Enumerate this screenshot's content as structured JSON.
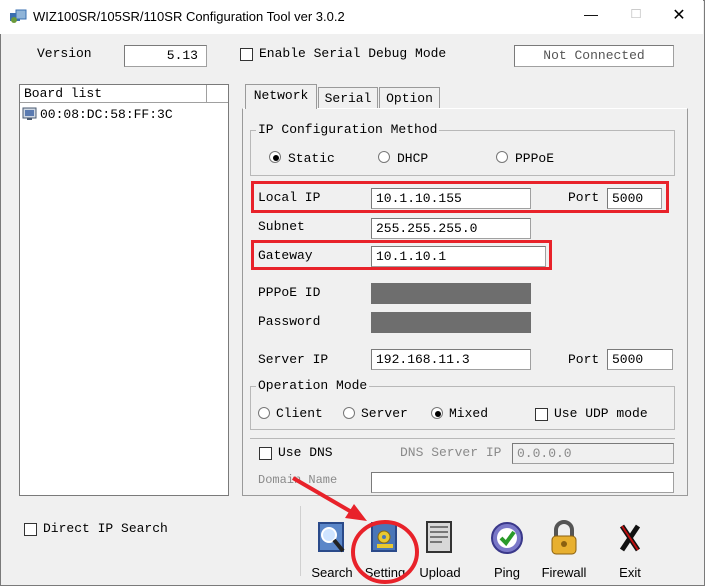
{
  "window": {
    "title": "WIZ100SR/105SR/110SR Configuration Tool ver 3.0.2"
  },
  "titlebar": {
    "minimize": "—",
    "maximize": "□",
    "close": "✕"
  },
  "top": {
    "version_label": "Version",
    "version_value": "5.13",
    "debug_label": "Enable Serial Debug Mode",
    "status": "Not Connected"
  },
  "board_list": {
    "header": "Board list",
    "items": [
      "00:08:DC:58:FF:3C"
    ]
  },
  "tabs": [
    "Network",
    "Serial",
    "Option"
  ],
  "ip_method": {
    "title": "IP Configuration Method",
    "options": [
      "Static",
      "DHCP",
      "PPPoE"
    ],
    "selected": "Static"
  },
  "network": {
    "local_ip_label": "Local IP",
    "local_ip": "10.1.10.155",
    "port_label": "Port",
    "port": "5000",
    "subnet_label": "Subnet",
    "subnet": "255.255.255.0",
    "gateway_label": "Gateway",
    "gateway": "10.1.10.1",
    "pppoe_id_label": "PPPoE ID",
    "password_label": "Password",
    "server_ip_label": "Server IP",
    "server_ip": "192.168.11.3",
    "server_port_label": "Port",
    "server_port": "5000"
  },
  "operation_mode": {
    "title": "Operation Mode",
    "options": [
      "Client",
      "Server",
      "Mixed"
    ],
    "selected": "Mixed",
    "udp_label": "Use UDP mode"
  },
  "dns": {
    "use_dns_label": "Use DNS",
    "dns_server_label": "DNS Server IP",
    "dns_server_ip": "0.0.0.0",
    "domain_label": "Domain Name",
    "domain_value": ""
  },
  "direct_ip_label": "Direct IP Search",
  "toolbar": {
    "search": "Search",
    "setting": "Setting",
    "upload": "Upload",
    "ping": "Ping",
    "firewall": "Firewall",
    "exit": "Exit"
  },
  "colors": {
    "highlight": "#e8222a",
    "window_bg": "#f0f0f0"
  }
}
